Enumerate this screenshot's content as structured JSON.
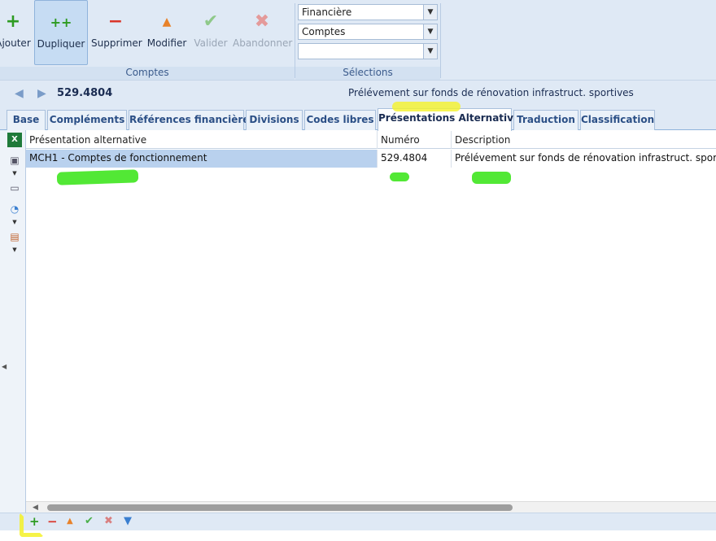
{
  "ribbon": {
    "buttons": [
      {
        "label": "Ajouter",
        "icon": "plus-icon"
      },
      {
        "label": "Dupliquer",
        "icon": "duplicate-icon"
      },
      {
        "label": "Supprimer",
        "icon": "minus-icon"
      },
      {
        "label": "Modifier",
        "icon": "edit-triangle-icon"
      },
      {
        "label": "Valider",
        "icon": "check-icon"
      },
      {
        "label": "Abandonner",
        "icon": "x-icon"
      }
    ],
    "group_caption": "Comptes",
    "selections": {
      "caption": "Sélections",
      "combo1": "Financière",
      "combo2": "Comptes",
      "combo3": ""
    }
  },
  "account": {
    "number": "529.4804",
    "description": "Prélévement sur fonds de rénovation infrastruct. sportives"
  },
  "tabs": [
    "Base",
    "Compléments",
    "Références financières",
    "Divisions",
    "Codes libres",
    "Présentations Alternatives",
    "Traduction",
    "Classification"
  ],
  "active_tab": "Présentations Alternatives",
  "grid": {
    "columns": [
      "Présentation alternative",
      "Numéro",
      "Description"
    ],
    "rows": [
      [
        "MCH1 - Comptes de fonctionnement",
        "529.4804",
        "Prélévement sur fonds de rénovation infrastruct. sportives"
      ]
    ]
  },
  "colors": {
    "accent": "#2b4f86",
    "ribbon_bg": "#dfe9f5",
    "green_marker": "#3fe61f",
    "yellow_marker": "#f5f229"
  }
}
